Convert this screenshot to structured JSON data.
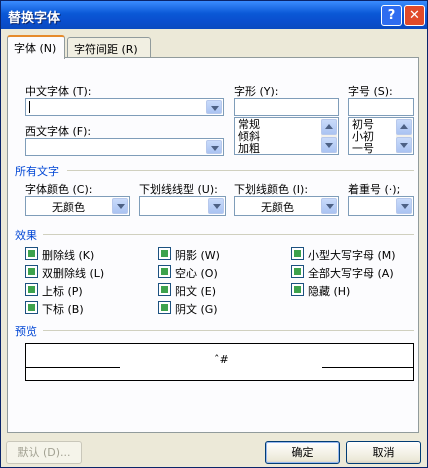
{
  "window": {
    "title": "替换字体",
    "help_button": "?",
    "close_button": "✕"
  },
  "tabs": [
    {
      "label": "字体 (N)",
      "active": true
    },
    {
      "label": "字符间距 (R)",
      "active": false
    }
  ],
  "font": {
    "chinese_font_label": "中文字体 (T):",
    "chinese_font_value": "",
    "western_font_label": "西文字体 (F):",
    "western_font_value": "",
    "style_label": "字形 (Y):",
    "style_value": "",
    "style_options": [
      "常规",
      "倾斜",
      "加粗"
    ],
    "size_label": "字号 (S):",
    "size_value": "",
    "size_options": [
      "初号",
      "小初",
      "一号"
    ]
  },
  "all_text": {
    "section_label": "所有文字",
    "font_color_label": "字体颜色 (C):",
    "font_color_value": "无颜色",
    "underline_type_label": "下划线线型 (U):",
    "underline_type_value": "",
    "underline_color_label": "下划线颜色 (I):",
    "underline_color_value": "无颜色",
    "emphasis_label": "着重号 (·);",
    "emphasis_value": ""
  },
  "effects": {
    "section_label": "效果",
    "items": [
      {
        "label": "删除线 (K)"
      },
      {
        "label": "双删除线 (L)"
      },
      {
        "label": "上标 (P)"
      },
      {
        "label": "下标 (B)"
      },
      {
        "label": "阴影 (W)"
      },
      {
        "label": "空心 (O)"
      },
      {
        "label": "阳文 (E)"
      },
      {
        "label": "阴文 (G)"
      },
      {
        "label": "小型大写字母 (M)"
      },
      {
        "label": "全部大写字母 (A)"
      },
      {
        "label": "隐藏 (H)"
      }
    ]
  },
  "preview": {
    "section_label": "预览",
    "sample_text": "ˆ#"
  },
  "buttons": {
    "default_label": "默认 (D)...",
    "ok_label": "确定",
    "cancel_label": "取消"
  },
  "colors": {
    "title_bar": "#0a58d6",
    "section_text": "#0046d5",
    "dialog_bg": "#ece9d8",
    "checkbox_fill": "#3da24d"
  }
}
